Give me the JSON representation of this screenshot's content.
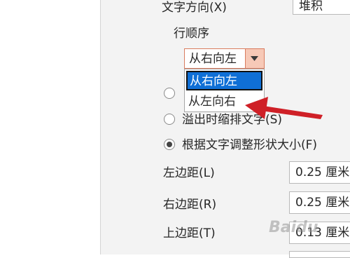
{
  "text_direction": {
    "label": "文字方向(X)",
    "value": "堆积"
  },
  "row_order": {
    "label": "行顺序",
    "selected": "从右向左",
    "options": [
      "从右向左",
      "从左向右"
    ]
  },
  "autofit": {
    "overflow_shrink_label": "溢出时缩排文字(S)",
    "resize_shape_label": "根据文字调整形状大小(F)"
  },
  "margins": {
    "left": {
      "label": "左边距(L)",
      "value": "0.25 厘米"
    },
    "right": {
      "label": "右边距(R)",
      "value": "0.25 厘米"
    },
    "top": {
      "label": "上边距(T)",
      "value": "0.13 厘米"
    }
  },
  "watermark": "Baidu",
  "colors": {
    "accent": "#d97c5f",
    "selection": "#0f6fd6",
    "annotation_arrow": "#d9252a"
  }
}
